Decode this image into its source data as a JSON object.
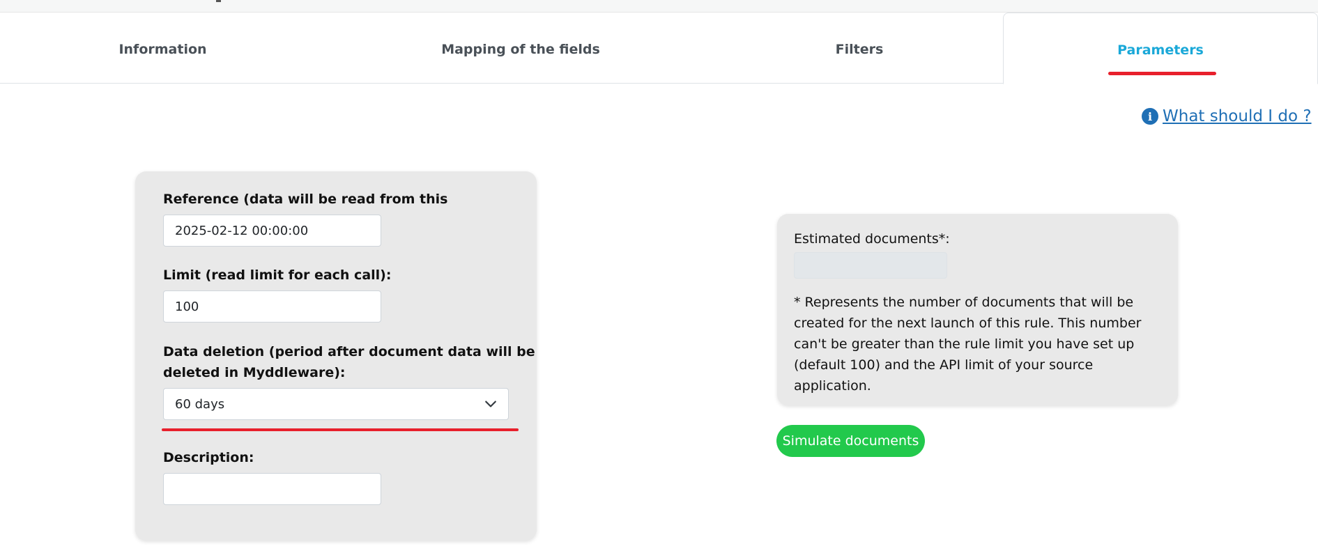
{
  "tabs": [
    {
      "label": "Information",
      "active": false
    },
    {
      "label": "Mapping of the fields",
      "active": false
    },
    {
      "label": "Filters",
      "active": false
    },
    {
      "label": "Parameters",
      "active": true
    }
  ],
  "help": {
    "icon": "info-icon",
    "label": " What should I do ?"
  },
  "params": {
    "reference": {
      "label": "Reference (data will be read from this parameter):",
      "value": "2025-02-12 00:00:00"
    },
    "limit": {
      "label": "Limit (read limit for each call):",
      "value": "100"
    },
    "deletion": {
      "label_line1": "Data deletion (period after document data will be",
      "label_line2": "deleted in Myddleware):",
      "selected": "60 days"
    },
    "description": {
      "label": "Description:",
      "value": ""
    }
  },
  "estimate": {
    "label": "Estimated documents*:",
    "value": "",
    "note": "* Represents the number of documents that will be created for the next launch of this rule. This number can't be greater than the rule limit you have set up (default 100) and the API limit of your source application."
  },
  "simulate": {
    "label": "Simulate documents"
  },
  "colors": {
    "active_tab": "#1aa8d8",
    "underline": "#e8202c",
    "link": "#1f6fb5",
    "button": "#22c94c",
    "card_bg": "#e9e9e9"
  }
}
